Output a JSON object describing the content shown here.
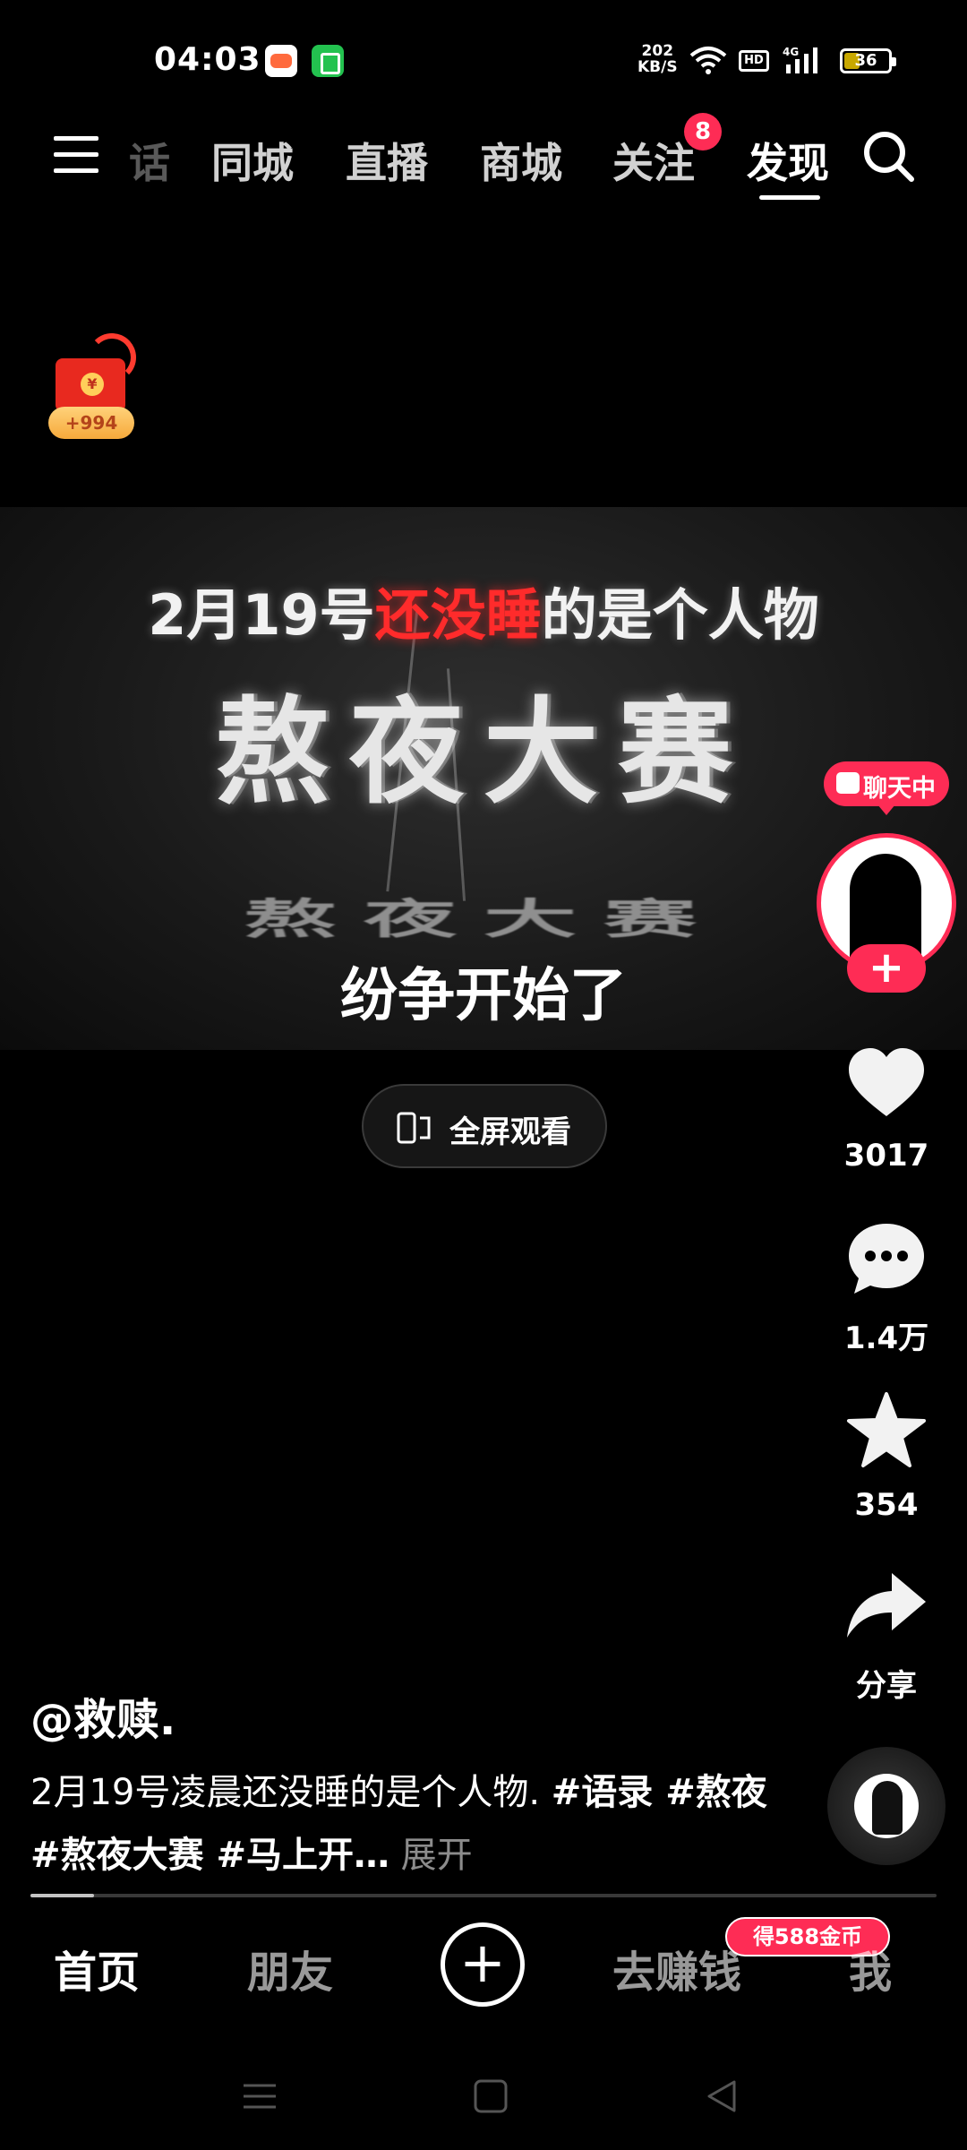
{
  "status_bar": {
    "time": "04:03",
    "net_speed_value": "202",
    "net_speed_unit": "KB/S",
    "hd_label": "HD",
    "network_label": "4G",
    "battery_level": "36"
  },
  "top_nav": {
    "tabs": [
      {
        "label": "话",
        "state": "partial"
      },
      {
        "label": "同城",
        "state": "normal"
      },
      {
        "label": "直播",
        "state": "normal"
      },
      {
        "label": "商城",
        "state": "normal"
      },
      {
        "label": "关注",
        "state": "normal"
      },
      {
        "label": "发现",
        "state": "active"
      }
    ],
    "follow_badge": "8"
  },
  "red_envelope": {
    "coin_symbol": "¥",
    "amount": "+994"
  },
  "video": {
    "line1_prefix": "2月19号",
    "line1_highlight": "还没睡",
    "line1_suffix": "的是个人物",
    "title": "熬夜大赛",
    "title_reflection": "熬夜大赛",
    "caption": "纷争开始了",
    "fullscreen_label": "全屏观看"
  },
  "right_rail": {
    "chat_label": "聊天中",
    "follow_symbol": "+",
    "likes": "3017",
    "comments": "1.4万",
    "favorites": "354",
    "share_label": "分享"
  },
  "post": {
    "author": "@救赎.",
    "text_before": "2月19号凌晨还没睡的是个人物. ",
    "tags": "#语录 #熬夜 #熬夜大赛 #马上开…",
    "expand_label": " 展开",
    "progress": 0.07
  },
  "bottom_nav": {
    "home": "首页",
    "friends": "朋友",
    "create": "+",
    "earn": "去赚钱",
    "earn_badge": "得588金币",
    "me": "我"
  },
  "colors": {
    "accent": "#fe2c55",
    "background": "#000000",
    "highlight_red": "#ff2b2b"
  },
  "icons": [
    "menu-icon",
    "search-icon",
    "heart-icon",
    "comment-icon",
    "star-icon",
    "share-icon",
    "wifi-icon",
    "signal-icon",
    "battery-icon",
    "fullscreen-icon"
  ]
}
